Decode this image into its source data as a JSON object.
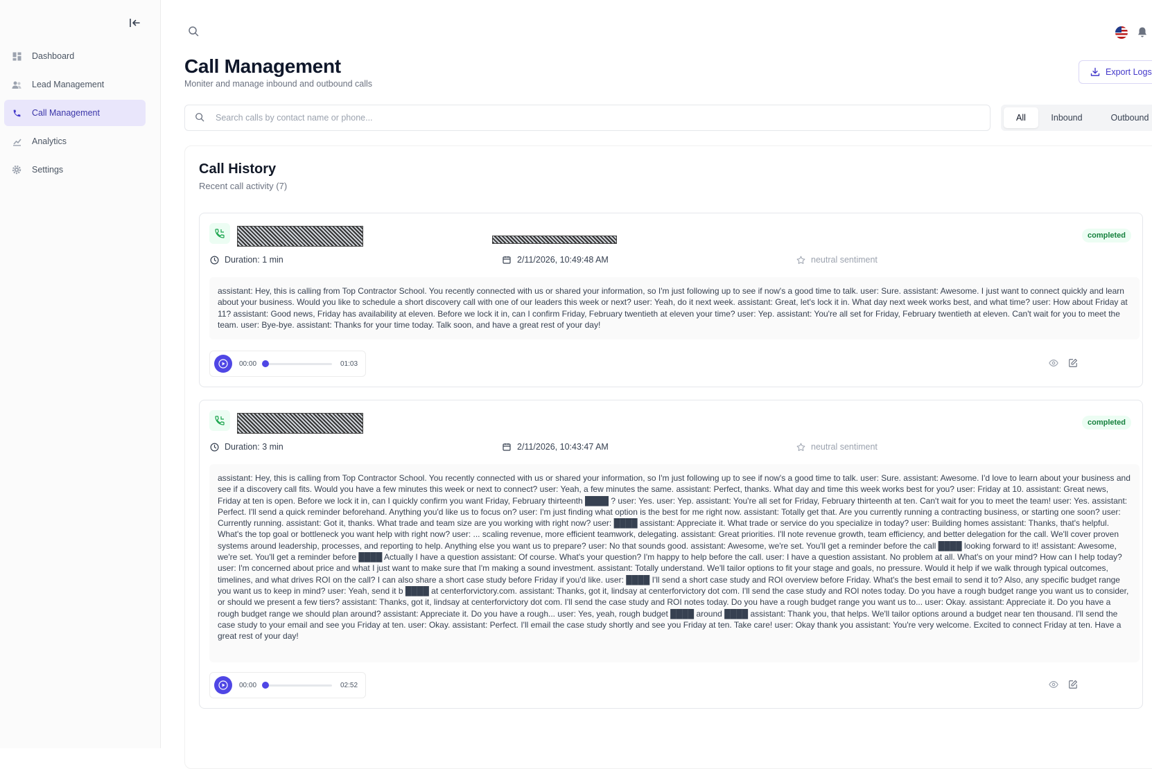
{
  "sidebar": {
    "items": [
      {
        "label": "Dashboard",
        "icon": "dashboard-icon"
      },
      {
        "label": "Lead Management",
        "icon": "users-icon"
      },
      {
        "label": "Call Management",
        "icon": "phone-icon",
        "active": true
      },
      {
        "label": "Analytics",
        "icon": "chart-icon"
      },
      {
        "label": "Settings",
        "icon": "gear-icon"
      }
    ]
  },
  "header": {
    "title": "Call Management",
    "subtitle": "Moniter and manage inbound and outbound calls",
    "export_label": "Export Logs"
  },
  "search": {
    "placeholder": "Search calls by contact name or phone..."
  },
  "filters": {
    "all": "All",
    "inbound": "Inbound",
    "outbound": "Outbound",
    "selected": "All"
  },
  "history": {
    "title": "Call History",
    "subtitle": "Recent call activity (7)"
  },
  "colors": {
    "accent": "#4f46e5",
    "active_bg": "#e9e6fb",
    "status_green": "#15803d"
  },
  "calls": [
    {
      "status": "completed",
      "duration": "Duration: 1 min",
      "datetime": "2/11/2026, 10:49:48 AM",
      "sentiment": "neutral sentiment",
      "transcript": "assistant: Hey, this is calling from Top Contractor School. You recently connected with us or shared your information, so I'm just following up to see if now's a good time to talk. user: Sure. assistant: Awesome. I just want to connect quickly and learn about your business. Would you like to schedule a short discovery call with one of our leaders this week or next? user: Yeah, do it next week. assistant: Great, let's lock it in. What day next week works best, and what time? user: How about Friday at 11? assistant: Good news, Friday has availability at eleven. Before we lock it in, can I confirm Friday, February twentieth at eleven your time? user: Yep. assistant: You're all set for Friday, February twentieth at eleven. Can't wait for you to meet the team. user: Bye-bye. assistant: Thanks for your time today. Talk soon, and have a great rest of your day!",
      "time_current": "00:00",
      "time_total": "01:03",
      "progress": 0
    },
    {
      "status": "completed",
      "duration": "Duration: 3 min",
      "datetime": "2/11/2026, 10:43:47 AM",
      "sentiment": "neutral sentiment",
      "transcript": "assistant: Hey, this is calling from Top Contractor School. You recently connected with us or shared your information, so I'm just following up to see if now's a good time to talk. user: Sure. assistant: Awesome. I'd love to learn about your business and see if a discovery call fits. Would you have a few minutes this week or next to connect? user: Yeah, a few minutes the same. assistant: Perfect, thanks. What day and time this week works best for you? user: Friday at 10. assistant: Great news, Friday at ten is open. Before we lock it in, can I quickly confirm you want Friday, February thirteenth ████ ? user: Yes. user: Yep. assistant: You're all set for Friday, February thirteenth at ten. Can't wait for you to meet the team! user: Yes. assistant: Perfect. I'll send a quick reminder beforehand. Anything you'd like us to focus on? user: I'm just finding what option is the best for me right now. assistant: Totally get that. Are you currently running a contracting business, or starting one soon? user: Currently running. assistant: Got it, thanks. What trade and team size are you working with right now? user: ████ assistant: Appreciate it. What trade or service do you specialize in today? user: Building homes assistant: Thanks, that's helpful. What's the top goal or bottleneck you want help with right now? user: ... scaling revenue, more efficient teamwork, delegating. assistant: Great priorities. I'll note revenue growth, team efficiency, and better delegation for the call. We'll cover proven systems around leadership, processes, and reporting to help. Anything else you want us to prepare? user: No that sounds good. assistant: Awesome, we're set. You'll get a reminder before the call ████ looking forward to it! assistant: Awesome, we're set. You'll get a reminder before ████ Actually I have a question assistant: Of course. What's your question? I'm happy to help before the call. user: I have a question assistant. No problem at all. What's on your mind? How can I help today? user: I'm concerned about price and what I just want to make sure that I'm making a sound investment. assistant: Totally understand. We'll tailor options to fit your stage and goals, no pressure. Would it help if we walk through typical outcomes, timelines, and what drives ROI on the call? I can also share a short case study before Friday if you'd like. user: ████ I'll send a short case study and ROI overview before Friday. What's the best email to send it to? Also, any specific budget range you want us to keep in mind? user: Yeah, send it b ████ at centerforvictory.com. assistant: Thanks, got it, lindsay at centerforvictory dot com. I'll send the case study and ROI notes today. Do you have a rough budget range you want us to consider, or should we present a few tiers? assistant: Thanks, got it, lindsay at centerforvictory dot com. I'll send the case study and ROI notes today. Do you have a rough budget range you want us to... user: Okay. assistant: Appreciate it. Do you have a rough budget range we should plan around? assistant: Appreciate it. Do you have a rough... user: Yes, yeah, rough budget ████ around ████ assistant: Thank you, that helps. We'll tailor options around a budget near ten thousand. I'll send the case study to your email and see you Friday at ten. user: Okay. assistant: Perfect. I'll email the case study shortly and see you Friday at ten. Take care! user: Okay thank you assistant: You're very welcome. Excited to connect Friday at ten. Have a great rest of your day!",
      "time_current": "00:00",
      "time_total": "02:52",
      "progress": 0
    }
  ]
}
